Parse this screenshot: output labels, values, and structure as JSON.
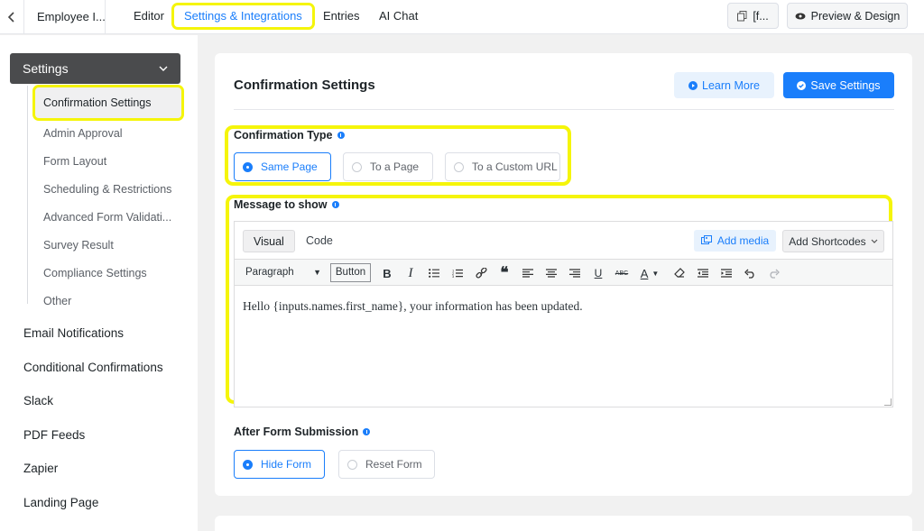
{
  "topbar": {
    "back_icon": "chevron-left-icon",
    "form_name": "Employee I...",
    "tabs": [
      "Editor",
      "Settings & Integrations",
      "Entries",
      "AI Chat"
    ],
    "shortcode_label": "[f...",
    "preview_label": "Preview & Design"
  },
  "sidebar": {
    "group_label": "Settings",
    "sub_items": [
      "Confirmation Settings",
      "Admin Approval",
      "Form Layout",
      "Scheduling & Restrictions",
      "Advanced Form Validati...",
      "Survey Result",
      "Compliance Settings",
      "Other"
    ],
    "links": [
      "Email Notifications",
      "Conditional Confirmations",
      "Slack",
      "PDF Feeds",
      "Zapier",
      "Landing Page"
    ]
  },
  "main": {
    "title": "Confirmation Settings",
    "learn_more": "Learn More",
    "save_settings": "Save Settings",
    "confirmation_type": {
      "label": "Confirmation Type",
      "options": [
        "Same Page",
        "To a Page",
        "To a Custom URL"
      ],
      "selected": "Same Page"
    },
    "message": {
      "label": "Message to show",
      "tabs": [
        "Visual",
        "Code"
      ],
      "active_tab": "Visual",
      "add_media": "Add media",
      "add_shortcodes": "Add Shortcodes",
      "format_select": "Paragraph",
      "button_label": "Button",
      "content": "Hello {inputs.names.first_name}, your information has been updated."
    },
    "after_submit": {
      "label": "After Form Submission",
      "options": [
        "Hide Form",
        "Reset Form"
      ],
      "selected": "Hide Form"
    }
  },
  "colors": {
    "accent": "#1a7efb",
    "highlight": "#f5f50a",
    "sidebar_header": "#4a4b4d"
  }
}
